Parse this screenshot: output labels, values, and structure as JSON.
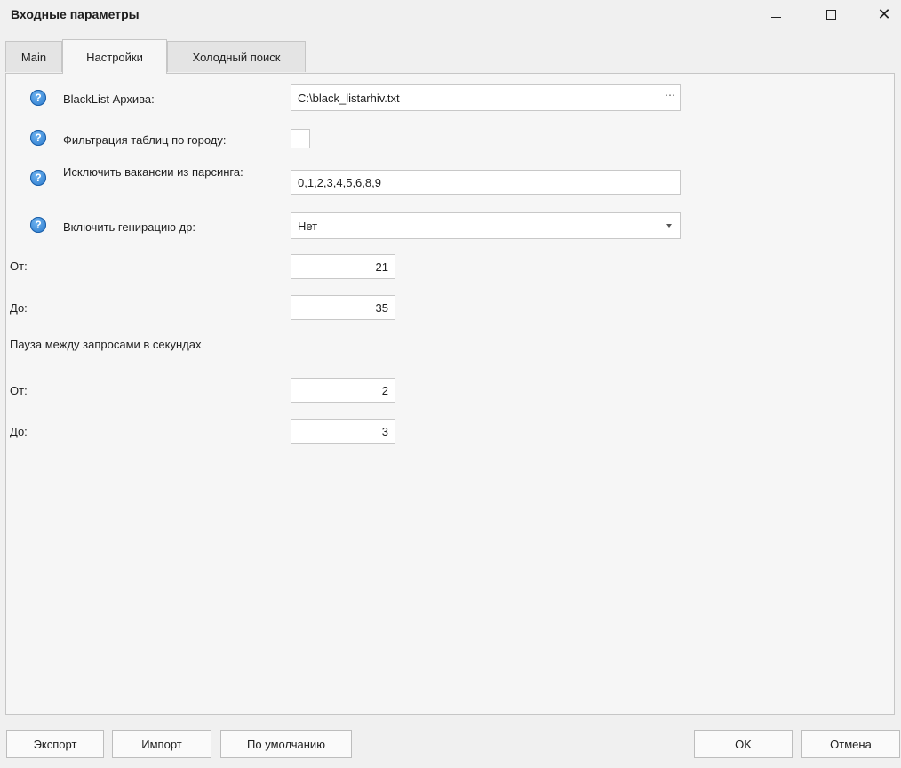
{
  "window": {
    "title": "Входные параметры",
    "minimize_icon": "minimize-icon",
    "maximize_icon": "maximize-icon",
    "close_icon": "close-icon"
  },
  "tabs": [
    {
      "label": "Main",
      "active": false
    },
    {
      "label": "Настройки",
      "active": true
    },
    {
      "label": "Холодный поиск",
      "active": false
    }
  ],
  "help_glyph": "?",
  "fields": {
    "blacklist": {
      "label": "BlackList Архива:",
      "value": "C:\\black_listarhiv.txt",
      "browse": "⋯"
    },
    "city_filter": {
      "label": "Фильтрация таблиц по городу:",
      "checked": false
    },
    "exclude": {
      "label": "Исключить вакансии из парсинга:",
      "value": "0,1,2,3,4,5,6,8,9"
    },
    "gen": {
      "label": "Включить генирацию др:",
      "value": "Нет"
    },
    "gen_from": {
      "label": "От:",
      "value": "21"
    },
    "gen_to": {
      "label": "До:",
      "value": "35"
    },
    "pause_heading": "Пауза между запросами в секундах",
    "pause_from": {
      "label": "От:",
      "value": "2"
    },
    "pause_to": {
      "label": "До:",
      "value": "3"
    }
  },
  "buttons": {
    "export": "Экспорт",
    "import": "Импорт",
    "default": "По умолчанию",
    "ok": "OK",
    "cancel": "Отмена"
  }
}
